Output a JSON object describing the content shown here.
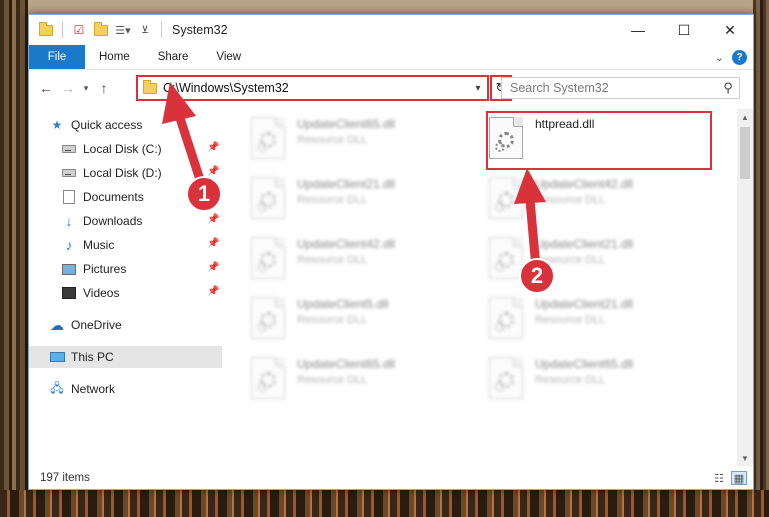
{
  "window": {
    "title": "System32",
    "controls": {
      "minimize": "—",
      "maximize": "☐",
      "close": "✕"
    }
  },
  "ribbon": {
    "file_tab": "File",
    "tabs": [
      "Home",
      "Share",
      "View"
    ],
    "expand_icon": "chevron-down-icon",
    "help": "?"
  },
  "navbar": {
    "address": "C:\\Windows\\System32",
    "search_placeholder": "Search System32"
  },
  "sidebar": {
    "quick_access": "Quick access",
    "pinned": [
      {
        "label": "Local Disk (C:)",
        "icon": "drive-icon"
      },
      {
        "label": "Local Disk (D:)",
        "icon": "drive-icon"
      },
      {
        "label": "Documents",
        "icon": "documents-icon"
      },
      {
        "label": "Downloads",
        "icon": "downloads-icon"
      },
      {
        "label": "Music",
        "icon": "music-icon"
      },
      {
        "label": "Pictures",
        "icon": "pictures-icon"
      },
      {
        "label": "Videos",
        "icon": "videos-icon"
      }
    ],
    "onedrive": "OneDrive",
    "this_pc": "This PC",
    "network": "Network"
  },
  "files": [
    {
      "name": "UpdateClient65.dll",
      "type": "Resource DLL",
      "blurred": true
    },
    {
      "name": "httpread.dll",
      "type": "",
      "blurred": false,
      "highlighted": true
    },
    {
      "name": "UpdateClient21.dll",
      "type": "Resource DLL",
      "blurred": true
    },
    {
      "name": "UpdateClient42.dll",
      "type": "Resource DLL",
      "blurred": true
    },
    {
      "name": "UpdateClient42.dll",
      "type": "Resource DLL",
      "blurred": true
    },
    {
      "name": "UpdateClient21.dll",
      "type": "Resource DLL",
      "blurred": true
    },
    {
      "name": "UpdateClient5.dll",
      "type": "Resource DLL",
      "blurred": true
    },
    {
      "name": "UpdateClient21.dll",
      "type": "Resource DLL",
      "blurred": true
    },
    {
      "name": "UpdateClient65.dll",
      "type": "Resource DLL",
      "blurred": true
    },
    {
      "name": "UpdateClient65.dll",
      "type": "Resource DLL",
      "blurred": true
    }
  ],
  "status": {
    "item_count": "197 items"
  },
  "annotations": {
    "step1": "1",
    "step2": "2",
    "color": "#d9323a"
  }
}
